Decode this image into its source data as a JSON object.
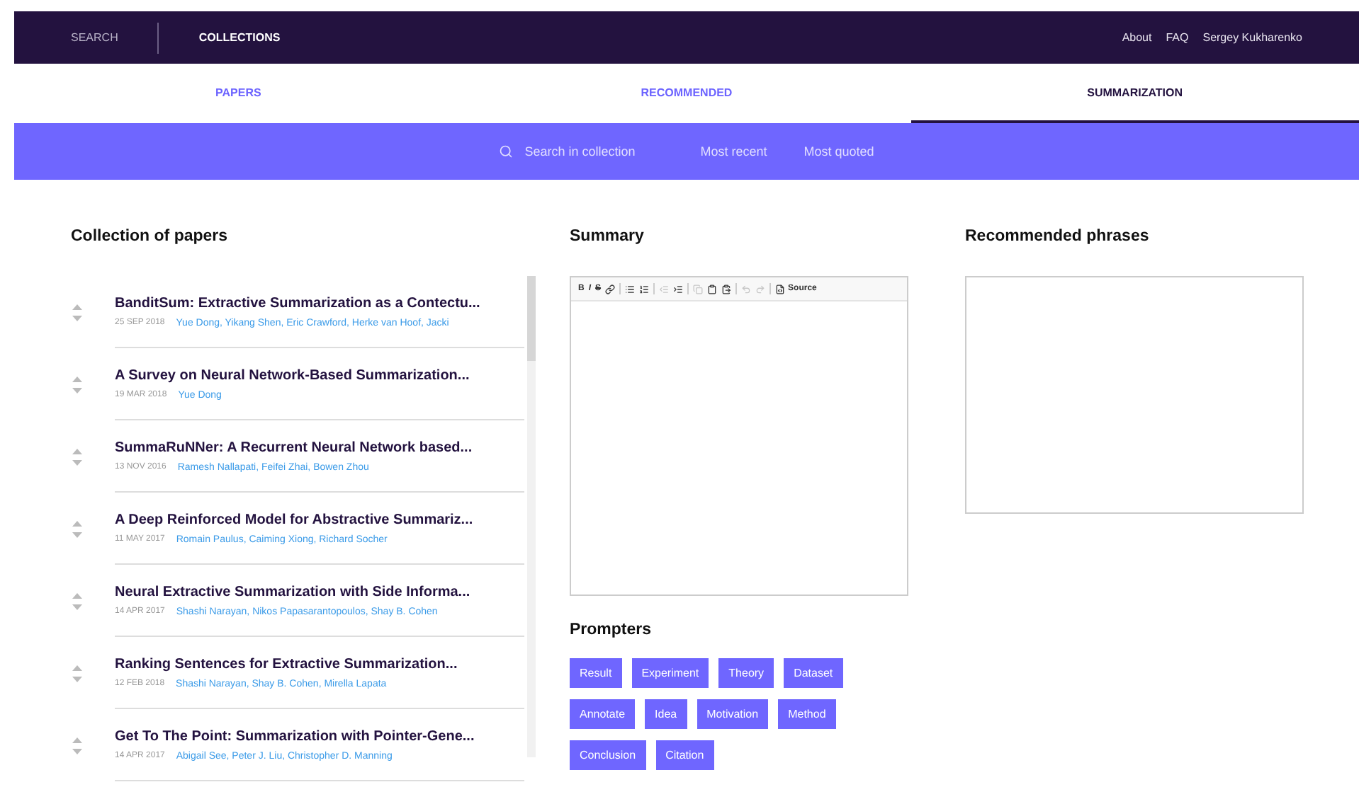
{
  "top_bar": {
    "left": [
      {
        "label": "SEARCH",
        "selected": false
      },
      {
        "label": "COLLECTIONS",
        "selected": true
      }
    ],
    "right": [
      "About",
      "FAQ",
      "Sergey Kukharenko"
    ]
  },
  "tabs": [
    {
      "label": "PAPERS",
      "selected": false
    },
    {
      "label": "RECOMMENDED",
      "selected": false
    },
    {
      "label": "SUMMARIZATION",
      "selected": true
    }
  ],
  "filter_bar": {
    "search_placeholder": "Search in collection",
    "links": [
      "Most recent",
      "Most quoted"
    ]
  },
  "collection": {
    "title": "Collection of papers",
    "papers": [
      {
        "title": "BanditSum: Extractive Summarization as a Contectu...",
        "date": "25 SEP 2018",
        "authors": "Yue Dong, Yikang Shen, Eric Crawford, Herke van Hoof, Jacki"
      },
      {
        "title": "A Survey on Neural Network-Based Summarization...",
        "date": "19 MAR 2018",
        "authors": "Yue Dong"
      },
      {
        "title": "SummaRuNNer: A Recurrent Neural Network based...",
        "date": "13 NOV 2016",
        "authors": "Ramesh Nallapati, Feifei Zhai, Bowen Zhou"
      },
      {
        "title": "A Deep Reinforced Model for Abstractive Summariz...",
        "date": "11 MAY 2017",
        "authors": "Romain Paulus, Caiming Xiong, Richard Socher"
      },
      {
        "title": "Neural Extractive Summarization with Side Informa...",
        "date": "14 APR 2017",
        "authors": "Shashi Narayan, Nikos Papasarantopoulos, Shay B. Cohen"
      },
      {
        "title": "Ranking Sentences for Extractive Summarization...",
        "date": "12 FEB 2018",
        "authors": "Shashi Narayan, Shay B. Cohen, Mirella Lapata"
      },
      {
        "title": "Get To The Point: Summarization with Pointer-Gene...",
        "date": "14 APR 2017",
        "authors": "Abigail See, Peter J. Liu, Christopher D. Manning"
      }
    ]
  },
  "summary": {
    "title": "Summary",
    "toolbar": [
      {
        "kind": "bold",
        "label": "B",
        "disabled": false
      },
      {
        "kind": "italic",
        "label": "I",
        "disabled": false
      },
      {
        "kind": "strike",
        "label": "S",
        "disabled": false
      },
      {
        "kind": "link",
        "disabled": false
      },
      {
        "kind": "separator"
      },
      {
        "kind": "bullets",
        "disabled": false
      },
      {
        "kind": "numbers",
        "disabled": false
      },
      {
        "kind": "separator"
      },
      {
        "kind": "outdent",
        "disabled": true
      },
      {
        "kind": "indent",
        "disabled": false
      },
      {
        "kind": "separator"
      },
      {
        "kind": "copy",
        "disabled": true
      },
      {
        "kind": "paste",
        "disabled": false
      },
      {
        "kind": "paste_text",
        "disabled": false
      },
      {
        "kind": "separator"
      },
      {
        "kind": "undo",
        "disabled": true
      },
      {
        "kind": "redo",
        "disabled": true
      },
      {
        "kind": "separator"
      },
      {
        "kind": "source",
        "label": "Source",
        "disabled": false
      }
    ]
  },
  "prompters": {
    "title": "Prompters",
    "tags": [
      "Result",
      "Experiment",
      "Theory",
      "Dataset",
      "Annotate",
      "Idea",
      "Motivation",
      "Method",
      "Conclusion",
      "Citation"
    ]
  },
  "recommended": {
    "title": "Recommended phrases"
  }
}
